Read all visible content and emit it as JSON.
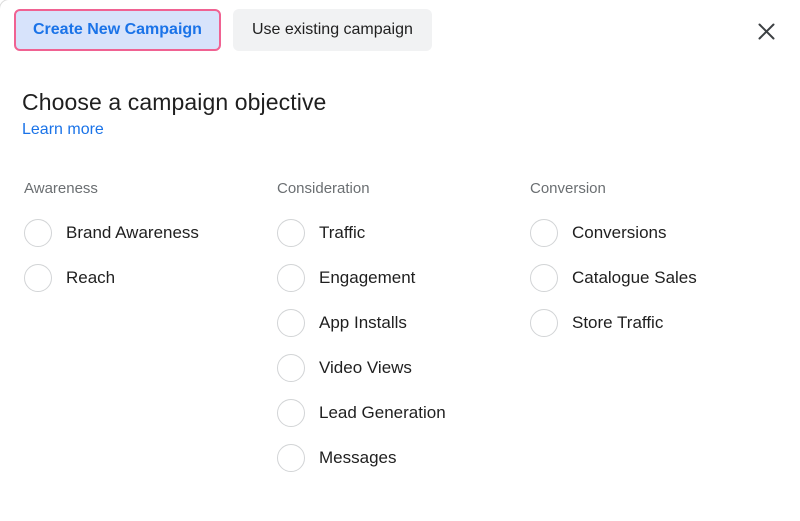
{
  "dialog": {
    "close_icon": "close-icon"
  },
  "tabs": [
    {
      "label": "Create New Campaign",
      "active": true
    },
    {
      "label": "Use existing campaign",
      "active": false
    }
  ],
  "heading": {
    "title": "Choose a campaign objective",
    "learn_more": "Learn more"
  },
  "columns": [
    {
      "title": "Awareness",
      "options": [
        {
          "label": "Brand Awareness",
          "selected": false
        },
        {
          "label": "Reach",
          "selected": false
        }
      ]
    },
    {
      "title": "Consideration",
      "options": [
        {
          "label": "Traffic",
          "selected": false
        },
        {
          "label": "Engagement",
          "selected": false
        },
        {
          "label": "App Installs",
          "selected": false
        },
        {
          "label": "Video Views",
          "selected": false
        },
        {
          "label": "Lead Generation",
          "selected": false
        },
        {
          "label": "Messages",
          "selected": false
        }
      ]
    },
    {
      "title": "Conversion",
      "options": [
        {
          "label": "Conversions",
          "selected": false
        },
        {
          "label": "Catalogue Sales",
          "selected": false
        },
        {
          "label": "Store Traffic",
          "selected": false
        }
      ]
    }
  ],
  "colors": {
    "active_tab_bg": "#d7e3fb",
    "active_tab_border": "#f06292",
    "active_tab_text": "#1a73e8",
    "inactive_tab_bg": "#f1f2f3",
    "link": "#1a73e8",
    "text": "#1f1f1f",
    "muted_text": "#6b6f72",
    "radio_border": "#d2d4d6"
  }
}
